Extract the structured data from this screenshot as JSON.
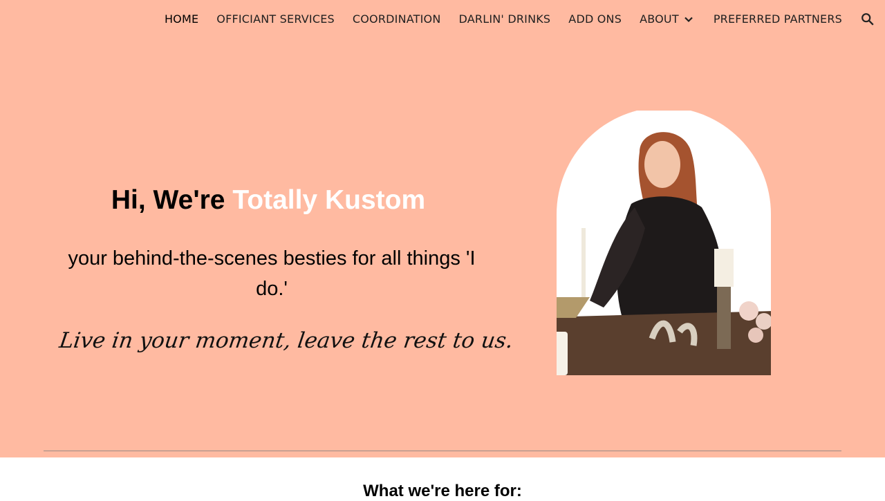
{
  "nav": {
    "items": [
      {
        "label": "HOME",
        "name": "nav-item-home",
        "active": true
      },
      {
        "label": "OFFICIANT SERVICES",
        "name": "nav-item-officiant-services"
      },
      {
        "label": "COORDINATION",
        "name": "nav-item-coordination"
      },
      {
        "label": "DARLIN' DRINKS",
        "name": "nav-item-darlin-drinks"
      },
      {
        "label": "ADD ONS",
        "name": "nav-item-add-ons"
      },
      {
        "label": "ABOUT",
        "name": "nav-item-about",
        "has_dropdown": true
      },
      {
        "label": "PREFERRED PARTNERS",
        "name": "nav-item-preferred-partners"
      }
    ],
    "search_icon": "search-icon",
    "dropdown_icon": "chevron-down-icon"
  },
  "hero": {
    "headline_prefix": "Hi, We're ",
    "headline_accent": "Totally Kustom",
    "subheadline": "your behind-the-scenes besties for all things 'I do.'",
    "tagline": "Live in your moment, leave the rest to us."
  },
  "section": {
    "title": "What we're here for:"
  },
  "colors": {
    "hero_background": "#ffbaa1",
    "accent_text": "#ffffff",
    "page_background": "#ffffff"
  }
}
